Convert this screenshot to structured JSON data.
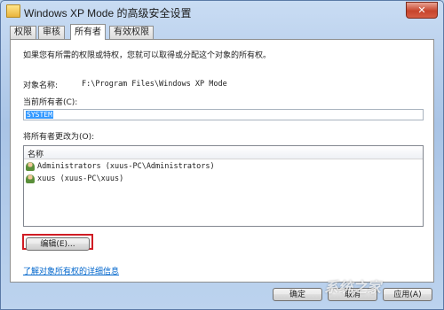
{
  "window": {
    "title": "Windows XP Mode 的高级安全设置",
    "close_symbol": "✕"
  },
  "tabs": [
    {
      "label": "权限"
    },
    {
      "label": "审核"
    },
    {
      "label": "所有者"
    },
    {
      "label": "有效权限"
    }
  ],
  "panel": {
    "intro": "如果您有所需的权限或特权，您就可以取得或分配这个对象的所有权。",
    "object_name_label": "对象名称:",
    "object_name_value": "F:\\Program Files\\Windows XP Mode",
    "current_owner_label": "当前所有者(C):",
    "current_owner_value": "SYSTEM",
    "change_owner_label": "将所有者更改为(O):",
    "list_header": "名称",
    "owners": [
      {
        "name": "Administrators (xuus-PC\\Administrators)",
        "icon": "group-users-icon"
      },
      {
        "name": "xuus (xuus-PC\\xuus)",
        "icon": "user-icon"
      }
    ],
    "edit_button": "编辑(E)...",
    "learn_more_link": "了解对象所有权的详细信息"
  },
  "footer": {
    "ok": "确定",
    "cancel": "取消",
    "apply": "应用(A)"
  },
  "watermark": "系统之家",
  "colors": {
    "highlight_border": "#d01c24",
    "selection": "#3399ff",
    "link": "#0066cc"
  }
}
